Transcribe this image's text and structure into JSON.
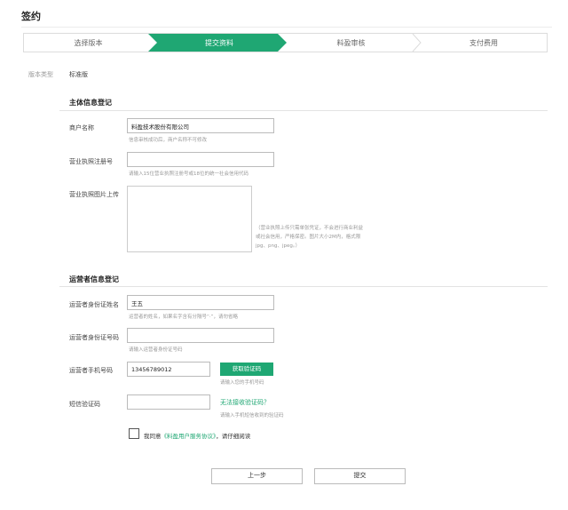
{
  "page": {
    "title": "签约"
  },
  "steps": [
    {
      "label": "选择版本",
      "active": false
    },
    {
      "label": "提交资料",
      "active": true
    },
    {
      "label": "料盈审核",
      "active": false
    },
    {
      "label": "支付费用",
      "active": false
    }
  ],
  "colors": {
    "accent": "#1fa773"
  },
  "version": {
    "label": "版本类型",
    "value": "标准版"
  },
  "subject": {
    "title": "主体信息登记",
    "merchant_name": {
      "label": "商户名称",
      "value": "料盈技术股份有限公司",
      "hint": "信息审核成功后，商户名称不可修改"
    },
    "license_no": {
      "label": "营业执照注册号",
      "value": "",
      "hint": "请输入15位营业执照注册号或18位的统一社会信用代码"
    },
    "license_upload": {
      "label": "营业执照图片上传",
      "hint": "（营业执照上传只需单张凭证，不会进行商业利益或社会信用，严格保密。图片大小2M内，格式限jpg、png、jpeg。）"
    }
  },
  "operator": {
    "title": "运营者信息登记",
    "id_name": {
      "label": "运营者身份证姓名",
      "value": "王五",
      "hint": "运营者的姓名，如果名字含有分隔号“·”，请勿省略"
    },
    "id_no": {
      "label": "运营者身份证号码",
      "value": "",
      "hint": "请输入运营者身份证号码"
    },
    "phone": {
      "label": "运营者手机号码",
      "value": "13456789012",
      "button": "获取验证码",
      "hint": "请输入您的手机号码"
    },
    "sms": {
      "label": "短信验证码",
      "value": "",
      "link": "无法接收验证码？",
      "hint": "请输入手机短信收到的验证码"
    }
  },
  "agreement": {
    "prefix": "我同意",
    "link": "《料盈用户服务协议》",
    "suffix": "，请仔细阅读"
  },
  "actions": {
    "prev": "上一步",
    "submit": "提交"
  }
}
